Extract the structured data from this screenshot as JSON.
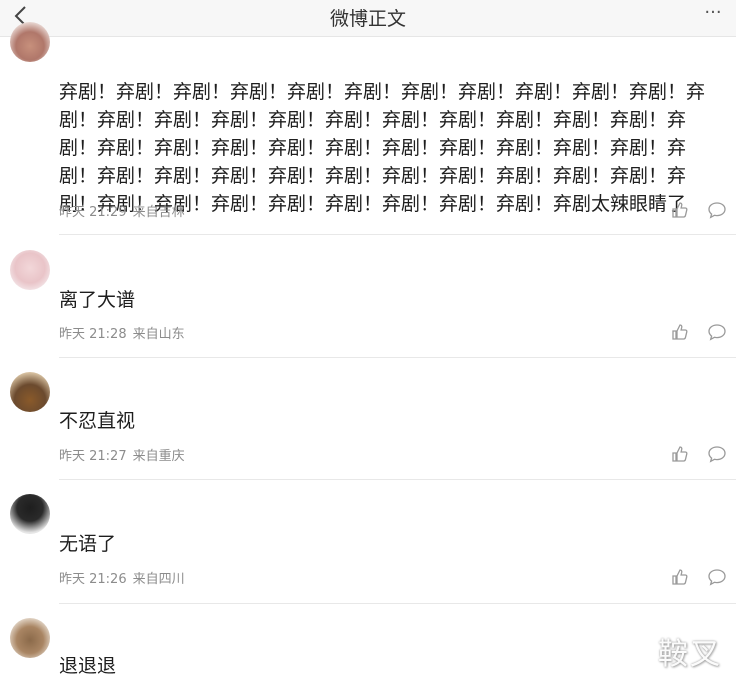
{
  "header": {
    "title": "微博正文",
    "back_icon": "chevron-left-icon",
    "more_label": "···"
  },
  "comments": [
    {
      "username": "",
      "text": "弃剧！弃剧！弃剧！弃剧！弃剧！弃剧！弃剧！弃剧！弃剧！弃剧！弃剧！弃剧！弃剧！弃剧！弃剧！弃剧！弃剧！弃剧！弃剧！弃剧！弃剧！弃剧！弃剧！弃剧！弃剧！弃剧！弃剧！弃剧！弃剧！弃剧！弃剧！弃剧！弃剧！弃剧！弃剧！弃剧！弃剧！弃剧！弃剧！弃剧！弃剧！弃剧！弃剧！弃剧！弃剧！弃剧！弃剧！弃剧！弃剧！弃剧！弃剧！弃剧！弃剧！弃剧太辣眼睛了",
      "time": "昨天 21:29",
      "location": "来自吉林"
    },
    {
      "username": "",
      "text": "离了大谱",
      "time": "昨天 21:28",
      "location": "来自山东"
    },
    {
      "username": "",
      "text": "不忍直视",
      "time": "昨天 21:27",
      "location": "来自重庆"
    },
    {
      "username": "",
      "text": "无语了",
      "time": "昨天 21:26",
      "location": "来自四川"
    },
    {
      "username": "",
      "text": "退退退",
      "time": "",
      "location": ""
    }
  ],
  "watermark": "鞍叉",
  "colors": {
    "topbar_bg": "#f7f7f7",
    "meta_text": "#8c8c8c",
    "divider": "#e8e8e8"
  }
}
